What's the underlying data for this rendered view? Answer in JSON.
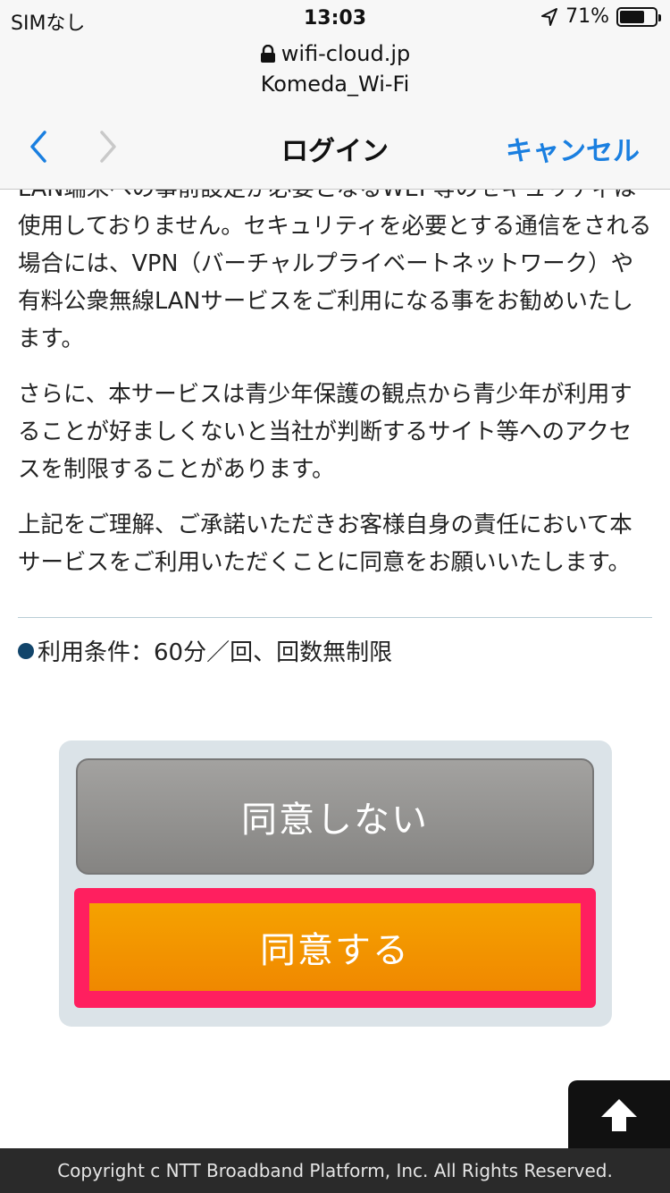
{
  "status_bar": {
    "carrier": "SIMなし",
    "time": "13:03",
    "battery_percent": "71%",
    "battery_level": 0.71,
    "location_icon": "location-arrow-icon"
  },
  "url_area": {
    "domain": "wifi-cloud.jp",
    "ssid": "Komeda_Wi-Fi",
    "lock_icon": "lock-icon"
  },
  "nav": {
    "title": "ログイン",
    "cancel_label": "キャンセル",
    "back_icon": "chevron-left-icon",
    "forward_icon": "chevron-right-icon"
  },
  "content": {
    "paragraphs": [
      "LAN端末への事前設定が必要となるWEP等のセキュリティは使用しておりません。セキュリティを必要とする通信をされる場合には、VPN（バーチャルプライベートネットワーク）や有料公衆無線LANサービスをご利用になる事をお勧めいたします。",
      "さらに、本サービスは青少年保護の観点から青少年が利用することが好ましくないと当社が判断するサイト等へのアクセスを制限することがあります。",
      "上記をご理解、ご承諾いただきお客様自身の責任において本サービスをご利用いただくことに同意をお願いいたします。"
    ],
    "condition": "利用条件：60分／回、回数無制限"
  },
  "buttons": {
    "disagree_label": "同意しない",
    "agree_label": "同意する"
  },
  "scroll_top_icon": "arrow-up-icon",
  "footer": {
    "copyright": "Copyright c NTT Broadband Platform, Inc. All Rights Reserved."
  },
  "colors": {
    "accent_blue": "#1a7fe0",
    "agree_orange": "#f5a200",
    "highlight_pink": "#ff1f5f",
    "disagree_gray": "#959492",
    "panel_bg": "#dbe3e8"
  }
}
